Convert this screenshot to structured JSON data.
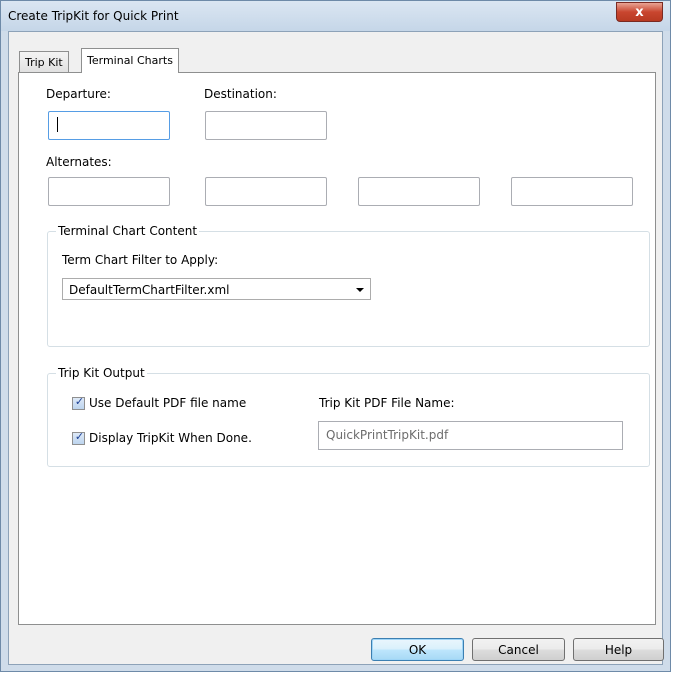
{
  "window": {
    "title": "Create TripKit for Quick Print",
    "close_label": "x"
  },
  "tabs": [
    {
      "label": "Trip Kit",
      "active": false
    },
    {
      "label": "Terminal Charts",
      "active": true
    }
  ],
  "departure": {
    "label": "Departure:",
    "value": ""
  },
  "destination": {
    "label": "Destination:",
    "value": ""
  },
  "alternates": {
    "label": "Alternates:",
    "values": [
      "",
      "",
      "",
      ""
    ]
  },
  "terminal_content": {
    "legend": "Terminal Chart Content",
    "filter_label": "Term Chart Filter to Apply:",
    "filter_value": "DefaultTermChartFilter.xml"
  },
  "output": {
    "legend": "Trip Kit Output",
    "use_default_label": "Use Default PDF file name",
    "use_default_checked": true,
    "display_label": "Display TripKit When Done.",
    "display_checked": true,
    "pdf_label": "Trip Kit PDF File Name:",
    "pdf_value": "QuickPrintTripKit.pdf"
  },
  "buttons": {
    "ok": "OK",
    "cancel": "Cancel",
    "help": "Help"
  },
  "colors": {
    "title_bg": "#c5d6e8",
    "close_red": "#c9462f",
    "focus_blue": "#569de5"
  }
}
